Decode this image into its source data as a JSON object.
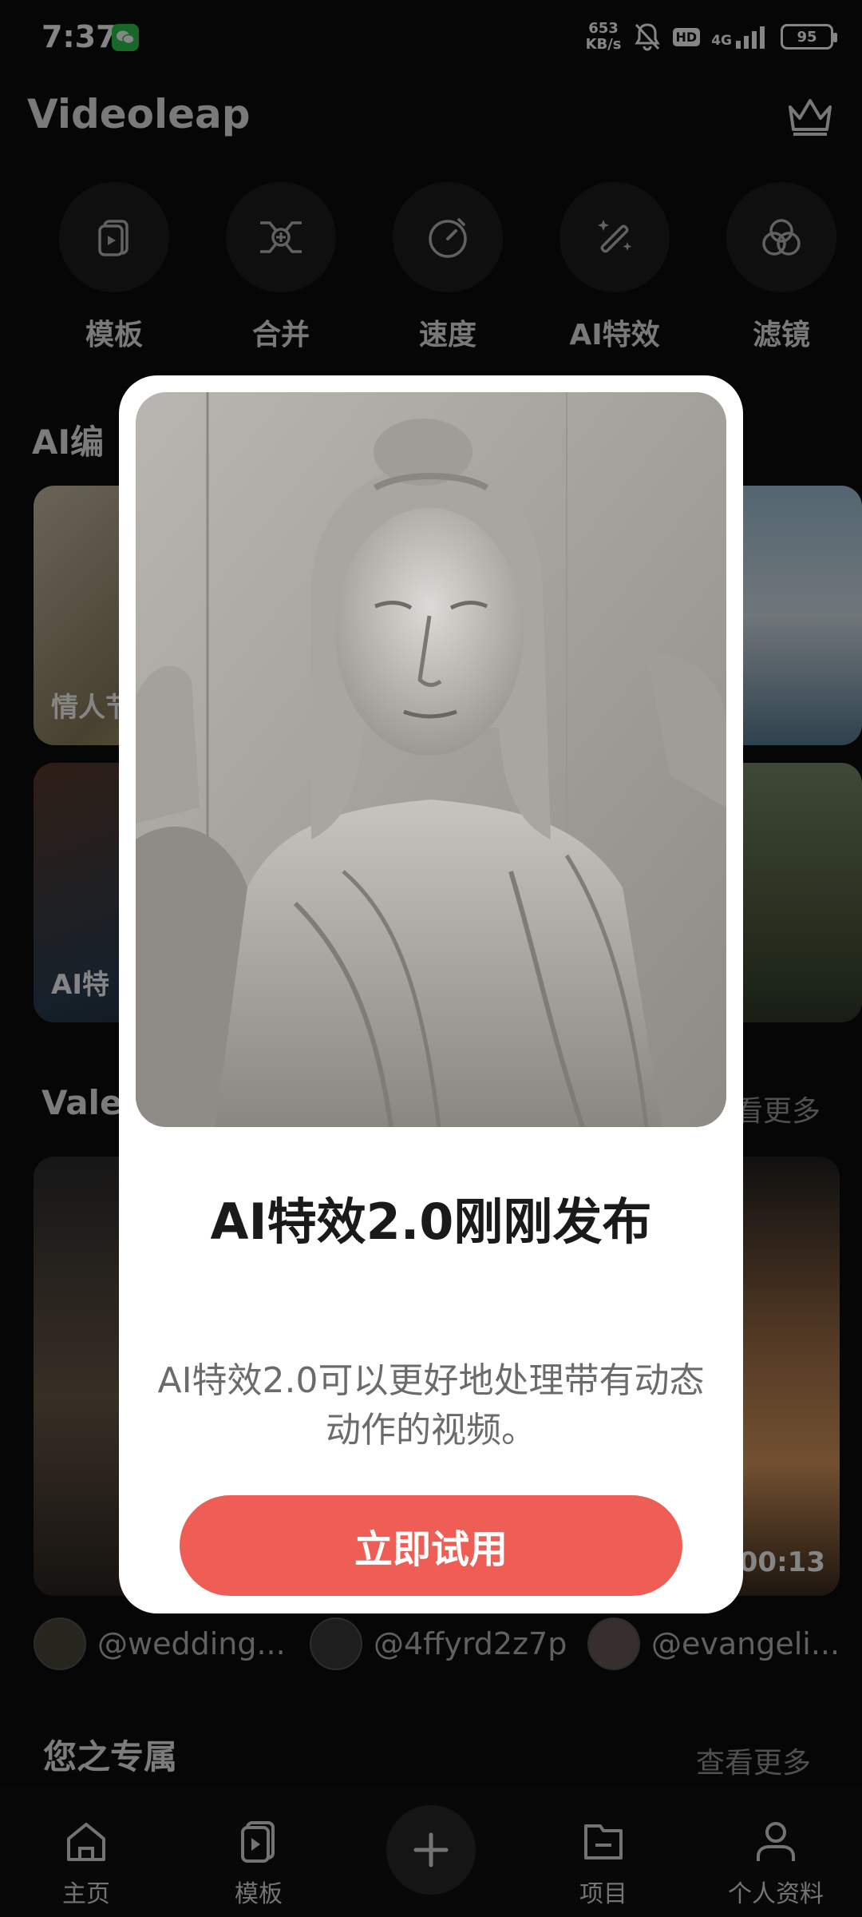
{
  "status_bar": {
    "time": "7:37",
    "network_speed_value": "653",
    "network_speed_unit": "KB/s",
    "hd_badge": "HD",
    "network_type": "4G",
    "battery": "95",
    "icons": [
      "wechat-icon",
      "mute-bell-icon",
      "signal-icon",
      "battery-icon"
    ]
  },
  "header": {
    "app_title": "Videoleap",
    "premium_icon": "crown-icon"
  },
  "tools": [
    {
      "label": "模板",
      "icon": "template-icon"
    },
    {
      "label": "合并",
      "icon": "merge-icon"
    },
    {
      "label": "速度",
      "icon": "speed-icon"
    },
    {
      "label": "AI特效",
      "icon": "magic-wand-icon"
    },
    {
      "label": "滤镜",
      "icon": "filter-icon"
    }
  ],
  "sections": {
    "ai_edit_title_visible": "AI编",
    "ai_cards": [
      {
        "label": "情人节"
      },
      {
        "label": "AI特"
      }
    ],
    "valentine_title_visible": "Vale",
    "valentine_see_more_visible": "看更多",
    "video_duration": "00:13",
    "for_you_title": "您之专属",
    "for_you_see_more": "查看更多"
  },
  "creators": [
    {
      "name": "@wedding..."
    },
    {
      "name": "@4ffyrd2z7p"
    },
    {
      "name": "@evangeli..."
    }
  ],
  "bottom_nav": {
    "items": [
      {
        "label": "主页",
        "icon": "home-icon"
      },
      {
        "label": "模板",
        "icon": "template-icon"
      },
      {
        "label": "项目",
        "icon": "folder-icon"
      },
      {
        "label": "个人资料",
        "icon": "profile-icon"
      }
    ],
    "add_icon": "plus-icon"
  },
  "modal": {
    "title": "AI特效2.0刚刚发布",
    "description": "AI特效2.0可以更好地处理带有动态动作的视频。",
    "button_label": "立即试用",
    "image_subject": "stone-sculpture-image"
  },
  "colors": {
    "background": "#0d0d0d",
    "accent": "#ee5e55",
    "modal_bg": "#ffffff"
  }
}
